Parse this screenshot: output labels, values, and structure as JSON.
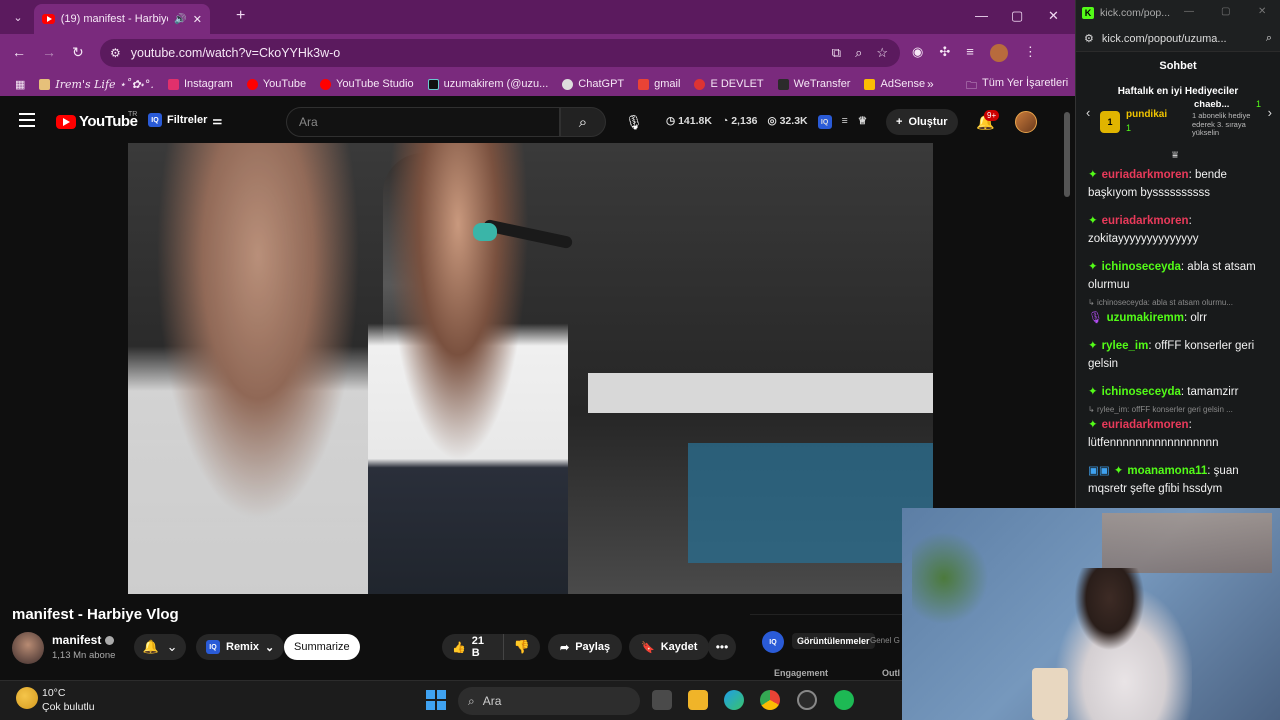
{
  "browser": {
    "tab_title": "(19) manifest - Harbiye Vlog",
    "url": "youtube.com/watch?v=CkoYYHk3w-o",
    "bookmarks": [
      "Irem's Life ⋆˚✿˖°.",
      "Instagram",
      "YouTube",
      "YouTube Studio",
      "uzumakirem (@uzu...",
      "ChatGPT",
      "gmail",
      "E DEVLET",
      "WeTransfer",
      "AdSense"
    ],
    "bookmarks_more": "»",
    "all_bookmarks": "Tüm Yer İşaretleri"
  },
  "youtube": {
    "logo_text": "YouTube",
    "region": "TR",
    "filters_label": "Filtreler",
    "search_placeholder": "Ara",
    "stats": [
      "141.8K",
      "2,136",
      "32.3K"
    ],
    "create_label": "Oluştur",
    "notif_count": "9+",
    "video_title": "manifest - Harbiye Vlog",
    "channel_name": "manifest",
    "subscribers": "1,13 Mn abone",
    "remix_label": "Remix",
    "summarize_label": "Summarize",
    "likes": "21 B",
    "share_label": "Paylaş",
    "save_label": "Kaydet",
    "iq_tab_active": "Görüntülenmeler",
    "iq_tab_other": "Genel G",
    "iq_engagement": "Engagement",
    "iq_out": "Outl"
  },
  "kick": {
    "window_title": "kick.com/pop...",
    "url": "kick.com/popout/uzuma...",
    "chat_title": "Sohbet",
    "gifters_title": "Haftalık en iyi Hediyeciler",
    "gifter1_name": "pundikai",
    "gifter1_count": "1",
    "gifter2_name": "chaeb...",
    "gifter2_count": "1",
    "gifter2_desc": "1 abonelik hediye ederek 3. sıraya yükselin",
    "messages": [
      {
        "user": "euriadarkmoren",
        "color": "#e83a5a",
        "text": ": bende başkıyom byssssssssss"
      },
      {
        "user": "euriadarkmoren",
        "color": "#e83a5a",
        "text": ": zokitayyyyyyyyyyyyyy"
      },
      {
        "user": "ichinoseceyda",
        "color": "#53fc18",
        "text": ": abla st atsam olurmuu"
      },
      {
        "reply": "ichinoseceyda: abla st atsam olurmu...",
        "user": "uzumakiremm",
        "color": "#53fc18",
        "text": ": olrr"
      },
      {
        "user": "rylee_im",
        "color": "#53fc18",
        "text": ": offFF konserler geri gelsin"
      },
      {
        "user": "ichinoseceyda",
        "color": "#53fc18",
        "text": ": tamamzirr"
      },
      {
        "reply": "rylee_im: offFF konserler geri gelsin ...",
        "user": "euriadarkmoren",
        "color": "#e83a5a",
        "text": ": lütfennnnnnnnnnnnnnnnn"
      },
      {
        "user": "moanamona11",
        "color": "#53fc18",
        "text": ": şuan mqsretr şefte gfibi hssdym"
      }
    ]
  },
  "taskbar": {
    "temperature": "10°C",
    "weather": "Çok bulutlu",
    "search_placeholder": "Ara"
  }
}
